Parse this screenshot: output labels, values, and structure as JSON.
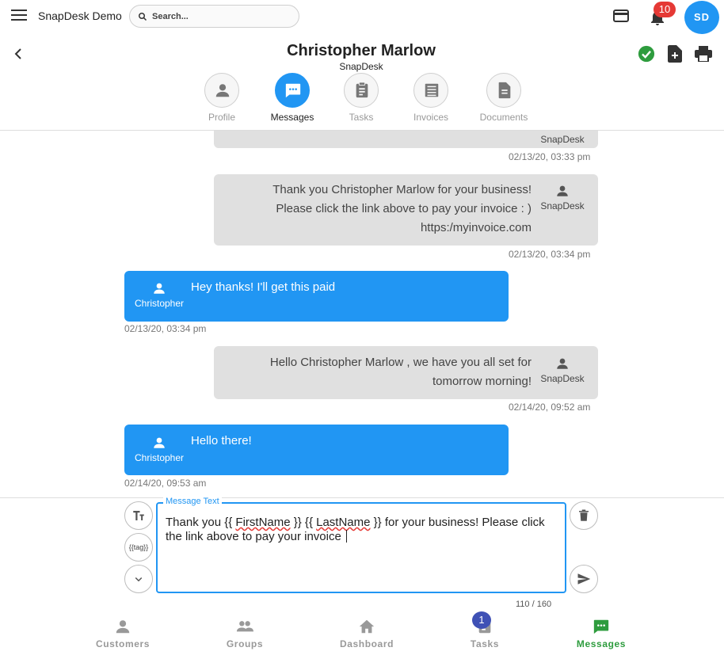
{
  "app": {
    "title": "SnapDesk Demo",
    "search_placeholder": "Search...",
    "notification_count": "10",
    "user_initials": "SD"
  },
  "header": {
    "customer_name": "Christopher Marlow",
    "company": "SnapDesk"
  },
  "tabs": [
    {
      "label": "Profile",
      "icon": "person-icon"
    },
    {
      "label": "Messages",
      "icon": "chat-icon",
      "active": true
    },
    {
      "label": "Tasks",
      "icon": "clipboard-icon"
    },
    {
      "label": "Invoices",
      "icon": "receipt-icon"
    },
    {
      "label": "Documents",
      "icon": "document-icon"
    }
  ],
  "messages": [
    {
      "direction": "out",
      "sender": "SnapDesk",
      "timestamp": "02/13/20, 03:33 pm"
    },
    {
      "direction": "out",
      "lines": [
        "Thank you Christopher Marlow for your business!",
        "Please click the link above to pay your invoice : )",
        "https:/myinvoice.com"
      ],
      "sender": "SnapDesk",
      "timestamp": "02/13/20, 03:34 pm"
    },
    {
      "direction": "in",
      "lines": [
        "Hey thanks! I'll get this paid"
      ],
      "sender": "Christopher",
      "timestamp": "02/13/20, 03:34 pm"
    },
    {
      "direction": "out",
      "lines": [
        "Hello Christopher Marlow , we have you all set for",
        "tomorrow morning!"
      ],
      "sender": "SnapDesk",
      "timestamp": "02/14/20, 09:52 am"
    },
    {
      "direction": "in",
      "lines": [
        "Hello there!"
      ],
      "sender": "Christopher",
      "timestamp": "02/14/20, 09:53 am"
    }
  ],
  "compose": {
    "legend": "Message Text",
    "text_parts": [
      "Thank you  {{ ",
      "FirstName",
      " }}  {{ ",
      "LastName",
      " }} for your business! Please click the link above to pay your invoice "
    ],
    "counter": "110 / 160",
    "tag_button_label": "{{tag}}"
  },
  "bottom_nav": [
    {
      "label": "Customers",
      "icon": "person-icon"
    },
    {
      "label": "Groups",
      "icon": "group-icon"
    },
    {
      "label": "Dashboard",
      "icon": "home-icon"
    },
    {
      "label": "Tasks",
      "icon": "task-icon",
      "badge": "1"
    },
    {
      "label": "Messages",
      "icon": "chat-icon",
      "active": true
    }
  ],
  "colors": {
    "accent": "#2196f3",
    "active_nav": "#2e9c3e",
    "badge_red": "#e53935",
    "badge_indigo": "#3f51b5",
    "outgoing_bubble": "#e0e0e0"
  }
}
